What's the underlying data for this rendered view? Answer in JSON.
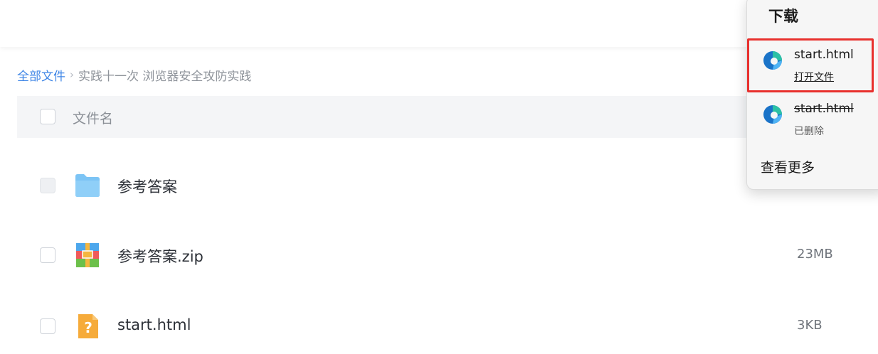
{
  "breadcrumb": {
    "root": "全部文件",
    "separator": "›",
    "current": "实践十一次 浏览器安全攻防实践"
  },
  "table": {
    "header_name": "文件名",
    "rows": [
      {
        "name": "参考答案",
        "size": "",
        "icon": "folder-icon"
      },
      {
        "name": "参考答案.zip",
        "size": "23MB",
        "icon": "archive-icon"
      },
      {
        "name": "start.html",
        "size": "3KB",
        "icon": "unknown-file-icon"
      }
    ]
  },
  "downloads": {
    "title": "下载",
    "items": [
      {
        "filename": "start.html",
        "action": "打开文件",
        "icon": "edge-icon"
      },
      {
        "filename": "start.html",
        "status": "已删除",
        "icon": "edge-icon"
      }
    ],
    "more": "查看更多"
  },
  "colors": {
    "link": "#3f86e6",
    "highlight": "#e8302d",
    "folder": "#7cc4f5",
    "unknown_file": "#f6ab3a"
  }
}
